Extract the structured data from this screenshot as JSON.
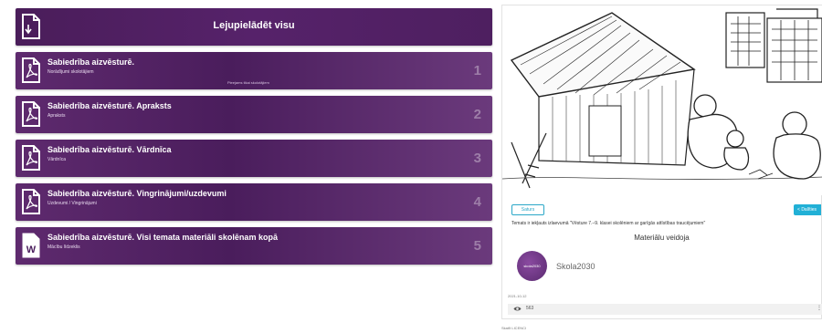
{
  "download_all": {
    "title": "Lejupielādēt visu"
  },
  "materials": [
    {
      "title": "Sabiedrība aizvēsturē.",
      "subtitle": "Norādījumi skolotājiem",
      "number": "1",
      "tooltip": "Pieejams tikai skolotājiem",
      "type": "pdf"
    },
    {
      "title": "Sabiedrība aizvēsturē. Apraksts",
      "subtitle": "Apraksts",
      "number": "2",
      "type": "pdf"
    },
    {
      "title": "Sabiedrība aizvēsturē. Vārdnīca",
      "subtitle": "Vārdnīca",
      "number": "3",
      "type": "pdf"
    },
    {
      "title": "Sabiedrība aizvēsturē. Vingrinājumi/uzdevumi",
      "subtitle": "Uzdevumi / Vingrinājumi",
      "number": "4",
      "type": "pdf"
    },
    {
      "title": "Sabiedrība aizvēsturē. Visi temata materiāli skolēnam kopā",
      "subtitle": "Mācību līdzeklis",
      "number": "5",
      "type": "word",
      "icon_letter": "W"
    }
  ],
  "preview": {
    "tag_button": "Saturs",
    "share_button": "Dalīties",
    "description": "Temats ir iekļauts izlaevumā \"Vēsture 7.–9. klasei skolēniem ar garīgās attīstības traucējumiem\"",
    "provider_heading": "Materiālu veidoja",
    "provider_logo_text": "skola2030",
    "provider_name": "Skola2030",
    "date": "2021-10-12",
    "views": "563",
    "more": "⋮",
    "license": "Skatīt LICENCI"
  },
  "colors": {
    "card_bg": "#5e2a6e",
    "accent": "#21b0d6"
  }
}
